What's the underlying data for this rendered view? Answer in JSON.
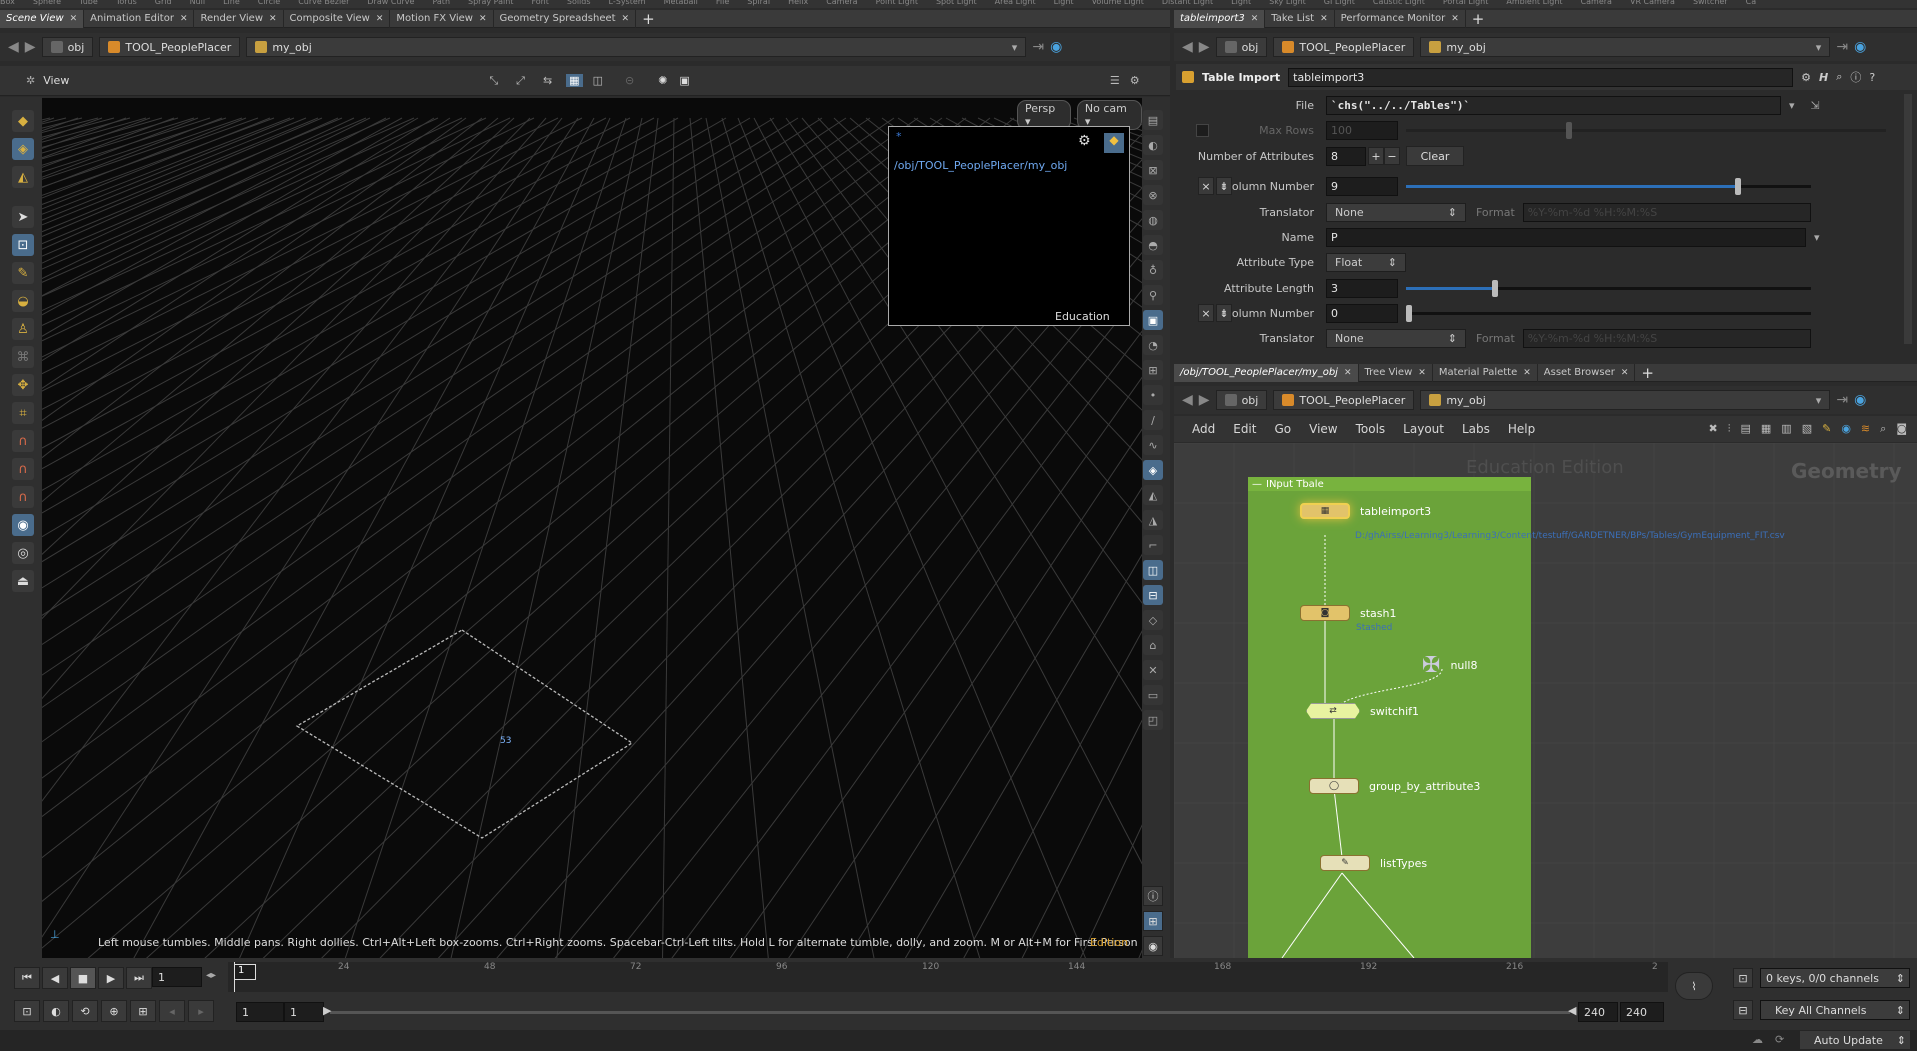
{
  "shelf": {
    "items": [
      "Box",
      "Sphere",
      "Tube",
      "Torus",
      "Grid",
      "Null",
      "Line",
      "Circle",
      "Curve Bezier",
      "Draw Curve",
      "Path",
      "Spray Paint",
      "Font",
      "Solids",
      "L-System",
      "Metaball",
      "File",
      "Spiral",
      "Helix",
      "Camera",
      "Point Light",
      "Spot Light",
      "Area Light",
      "Light",
      "Volume Light",
      "Distant Light",
      "Light",
      "Sky Light",
      "GI Light",
      "Caustic Light",
      "Portal Light",
      "Ambient Light",
      "Camera",
      "VR Camera",
      "Switcher",
      "Ca"
    ]
  },
  "left_tabs": [
    {
      "label": "Scene View",
      "active": true
    },
    {
      "label": "Animation Editor"
    },
    {
      "label": "Render View"
    },
    {
      "label": "Composite View"
    },
    {
      "label": "Motion FX View"
    },
    {
      "label": "Geometry Spreadsheet"
    }
  ],
  "path": {
    "obj": "obj",
    "asset": "TOOL_PeoplePlacer",
    "node": "my_obj"
  },
  "viewer": {
    "title": "View",
    "persp": "Persp",
    "cam": "No cam",
    "inset_path": "/obj/TOOL_PeoplePlacer/my_obj",
    "inset_label": "Education",
    "inset_dot": "*",
    "status": "Left mouse tumbles. Middle pans. Right dollies. Ctrl+Alt+Left box-zooms. Ctrl+Right zooms. Spacebar-Ctrl-Left tilts. Hold L for alternate tumble, dolly, and zoom.    M or Alt+M for First Person Navigation.",
    "edition": "Edition",
    "marker": "53"
  },
  "param_tabs": [
    {
      "label": "tableimport3",
      "active": true
    },
    {
      "label": "Take List"
    },
    {
      "label": "Performance Monitor"
    }
  ],
  "params": {
    "node_type": "Table Import",
    "node_name": "tableimport3",
    "file_label": "File",
    "file_value": "`chs(\"../../Tables\")`",
    "maxrows_label": "Max Rows",
    "maxrows_value": "100",
    "numattr_label": "Number of Attributes",
    "numattr_value": "8",
    "clear_label": "Clear",
    "col1_label": "Column Number",
    "col1_value": "9",
    "col1_fraction": 0.82,
    "trans1_label": "Translator",
    "trans1_value": "None",
    "format_label": "Format",
    "format_value": "%Y-%m-%d %H:%M:%S",
    "name_label": "Name",
    "name_value": "P",
    "atype_label": "Attribute Type",
    "atype_value": "Float",
    "alen_label": "Attribute Length",
    "alen_value": "3",
    "alen_fraction": 0.22,
    "col2_label": "Column Number",
    "col2_value": "0",
    "trans2_label": "Translator",
    "trans2_value": "None"
  },
  "network_tabs": [
    {
      "label": "/obj/TOOL_PeoplePlacer/my_obj",
      "active": true
    },
    {
      "label": "Tree View"
    },
    {
      "label": "Material Palette"
    },
    {
      "label": "Asset Browser"
    }
  ],
  "network_menu": [
    "Add",
    "Edit",
    "Go",
    "View",
    "Tools",
    "Layout",
    "Labs",
    "Help"
  ],
  "network": {
    "watermark": "Education Edition",
    "context": "Geometry",
    "box_title": "INput Tbale",
    "nodes": {
      "tableimport3": "tableimport3",
      "tableimport3_path": "D:/ghAirss/Learning3/Learning3/Content/testuff/GARDETNER/BPs/Tables/GymEquipment_FIT.csv",
      "stash1": "stash1",
      "stash1_sub": "Stashed",
      "null8": "null8",
      "switchif1": "switchif1",
      "group": "group_by_attribute3",
      "listTypes": "listTypes"
    }
  },
  "timeline": {
    "frame": "1",
    "marker": "1",
    "ticks": [
      "24",
      "48",
      "72",
      "96",
      "120",
      "144",
      "168",
      "192",
      "216",
      "2"
    ],
    "start1": "1",
    "start2": "1",
    "end1": "240",
    "end2": "240",
    "keys": "0 keys, 0/0 channels",
    "key_all": "Key All Channels",
    "auto_update": "Auto Update"
  }
}
